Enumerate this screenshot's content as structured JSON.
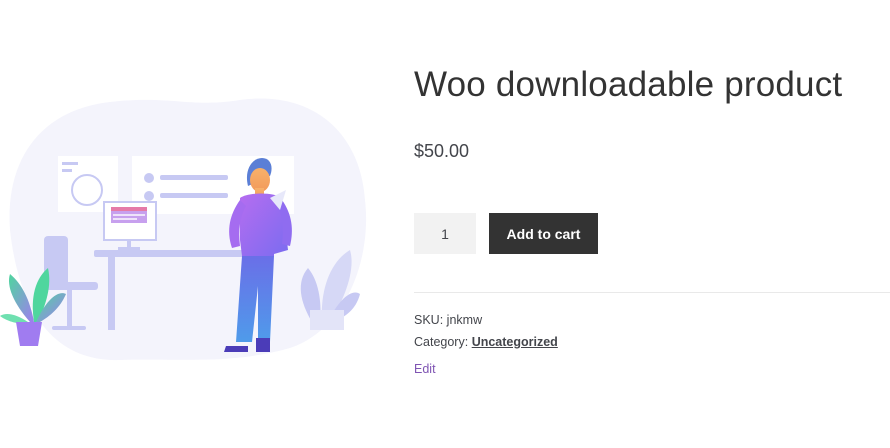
{
  "product": {
    "title": "Woo downloadable product",
    "price": "$50.00",
    "quantity": "1",
    "add_to_cart_label": "Add to cart",
    "sku_label": "SKU:",
    "sku_value": "jnkmw",
    "category_label": "Category:",
    "category_value": "Uncategorized",
    "edit_label": "Edit"
  },
  "colors": {
    "accent_purple": "#7f54b3",
    "button_bg": "#333333",
    "blob_bg": "#f4f4fc",
    "illustration_lavender": "#c7c9f3"
  }
}
